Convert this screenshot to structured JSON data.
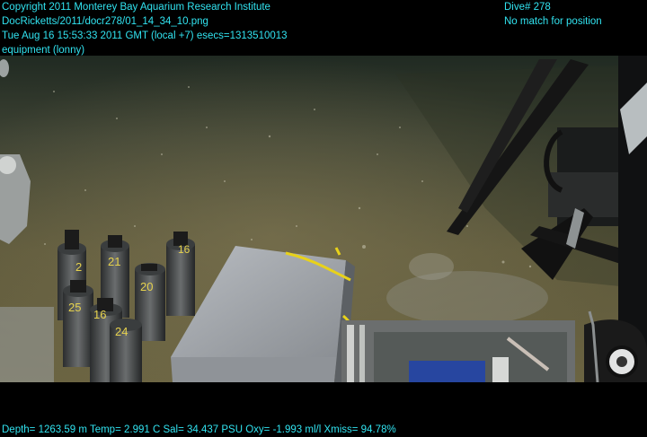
{
  "overlay": {
    "copyright": "Copyright 2011 Monterey Bay Aquarium Research Institute",
    "file_path": "DocRicketts/2011/docr278/01_14_34_10.png",
    "timestamp": "Tue Aug 16 15:53:33 2011 GMT (local +7)  esecs=1313510013",
    "camera": "equipment (lonny)",
    "dive": "Dive# 278",
    "position_status": "No match for position"
  },
  "telemetry": {
    "depth": "Depth= 1263.59 m",
    "temp": "Temp= 2.991 C",
    "salinity": "Sal= 34.437 PSU",
    "oxygen": "Oxy= -1.993 ml/l",
    "transmission": "Xmiss= 94.78%"
  },
  "core_tube_labels": [
    "2",
    "21",
    "20",
    "16",
    "25",
    "16",
    "24"
  ],
  "colors": {
    "hud_text": "#31e3f0",
    "seafloor": "#5f5a3c",
    "rope": "#e8d21a"
  }
}
